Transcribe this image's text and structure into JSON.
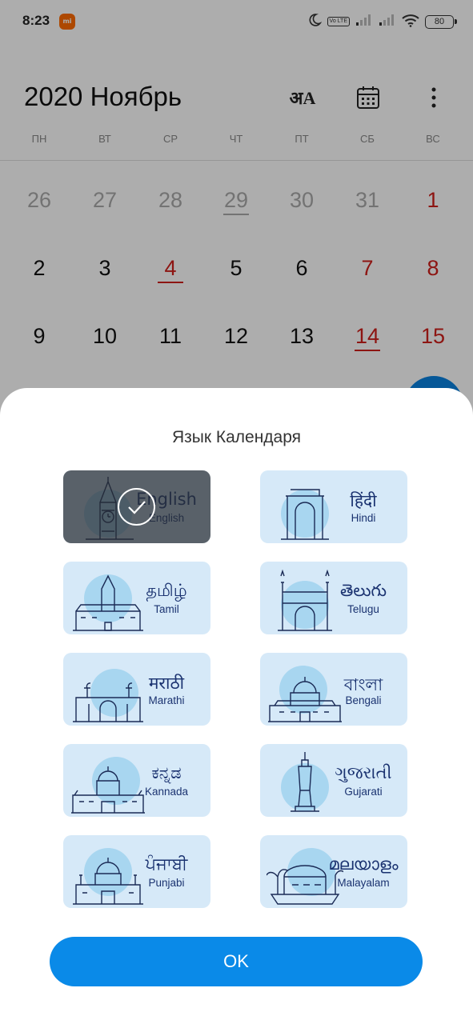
{
  "status_bar": {
    "time": "8:23",
    "battery": "80",
    "volte": "Vo LTE",
    "icons": [
      "xiaomi-app-icon",
      "moon-icon",
      "volte-icon",
      "signal-icon",
      "signal-icon",
      "wifi-icon",
      "battery-icon"
    ]
  },
  "header": {
    "title": "2020 Ноябрь",
    "translate_glyph": "अA"
  },
  "weekdays": [
    "ПН",
    "ВТ",
    "СР",
    "ЧТ",
    "ПТ",
    "СБ",
    "ВС"
  ],
  "weeks": [
    [
      {
        "d": "26",
        "muted": true
      },
      {
        "d": "27",
        "muted": true
      },
      {
        "d": "28",
        "muted": true
      },
      {
        "d": "29",
        "muted": true,
        "ul": true
      },
      {
        "d": "30",
        "muted": true
      },
      {
        "d": "31",
        "muted": true
      },
      {
        "d": "1",
        "red": true
      }
    ],
    [
      {
        "d": "2"
      },
      {
        "d": "3"
      },
      {
        "d": "4",
        "red": true,
        "ul": true
      },
      {
        "d": "5"
      },
      {
        "d": "6"
      },
      {
        "d": "7",
        "red": true
      },
      {
        "d": "8",
        "red": true
      }
    ],
    [
      {
        "d": "9"
      },
      {
        "d": "10"
      },
      {
        "d": "11"
      },
      {
        "d": "12"
      },
      {
        "d": "13"
      },
      {
        "d": "14",
        "red": true,
        "ul": true
      },
      {
        "d": "15",
        "red": true
      }
    ]
  ],
  "sheet": {
    "title": "Язык Календаря",
    "languages": [
      {
        "key": "english",
        "native": "English",
        "latin": "English",
        "selected": true,
        "icon": "big-ben-icon"
      },
      {
        "key": "hindi",
        "native": "हिंदी",
        "latin": "Hindi",
        "icon": "india-gate-icon"
      },
      {
        "key": "tamil",
        "native": "தமிழ்",
        "latin": "Tamil",
        "icon": "madras-building-icon"
      },
      {
        "key": "telugu",
        "native": "తెలుగు",
        "latin": "Telugu",
        "icon": "charminar-icon"
      },
      {
        "key": "marathi",
        "native": "मराठी",
        "latin": "Marathi",
        "icon": "gateway-of-india-icon"
      },
      {
        "key": "bengali",
        "native": "বাংলা",
        "latin": "Bengali",
        "icon": "victoria-memorial-icon"
      },
      {
        "key": "kannada",
        "native": "ಕನ್ನಡ",
        "latin": "Kannada",
        "icon": "mysore-palace-icon"
      },
      {
        "key": "gujarati",
        "native": "ગુજરાતી",
        "latin": "Gujarati",
        "icon": "statue-of-unity-icon"
      },
      {
        "key": "punjabi",
        "native": "ਪੰਜਾਬੀ",
        "latin": "Punjabi",
        "icon": "golden-temple-icon"
      },
      {
        "key": "malayalam",
        "native": "മലയാളം",
        "latin": "Malayalam",
        "icon": "houseboat-icon"
      }
    ],
    "ok_label": "OK"
  },
  "colors": {
    "accent": "#0a8ae8",
    "card_bg": "#d6e9f8",
    "card_text": "#1a3270",
    "weekend_red": "#d0201b"
  }
}
